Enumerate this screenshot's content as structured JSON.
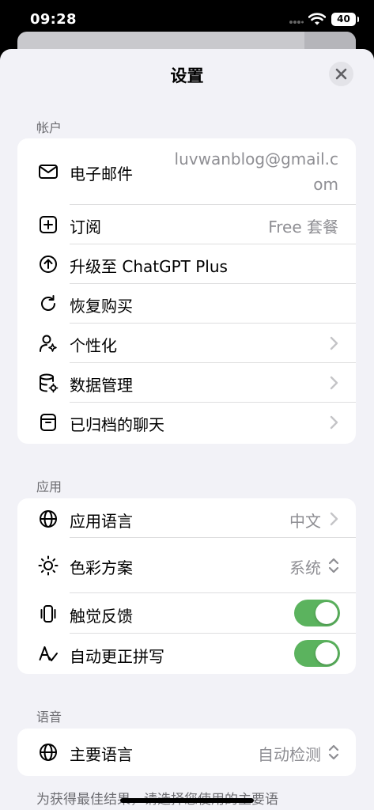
{
  "status_bar": {
    "time": "09:28",
    "battery": "40"
  },
  "sheet": {
    "title": "设置"
  },
  "account": {
    "section_label": "帐户",
    "email": {
      "label": "电子邮件",
      "value_line1": "luvwanblog@gmail.c",
      "value_line2": "om"
    },
    "subscription": {
      "label": "订阅",
      "value": "Free 套餐"
    },
    "upgrade": {
      "label": "升级至 ChatGPT Plus"
    },
    "restore": {
      "label": "恢复购买"
    },
    "personalization": {
      "label": "个性化"
    },
    "data_controls": {
      "label": "数据管理"
    },
    "archived": {
      "label": "已归档的聊天"
    }
  },
  "app": {
    "section_label": "应用",
    "language": {
      "label": "应用语言",
      "value": "中文"
    },
    "color_scheme": {
      "label": "色彩方案",
      "value": "系统"
    },
    "haptics": {
      "label": "触觉反馈",
      "on": true
    },
    "autocorrect": {
      "label": "自动更正拼写",
      "on": true
    }
  },
  "speech": {
    "section_label": "语音",
    "main_language": {
      "label": "主要语言",
      "value": "自动检测"
    },
    "note": "为获得最佳结果，请选择您使用的主要语"
  },
  "icons": [
    "signal-dots-icon",
    "wifi-icon",
    "battery-icon",
    "close-icon",
    "mail-icon",
    "plus-square-icon",
    "arrow-up-circle-icon",
    "restore-icon",
    "person-sparkle-icon",
    "database-gear-icon",
    "archive-box-icon",
    "globe-icon",
    "sun-icon",
    "haptics-phone-icon",
    "autocorrect-icon",
    "chevron-right-icon",
    "chevron-updown-icon"
  ],
  "colors": {
    "toggle_on": "#5bb35e",
    "background": "#f2f2f7",
    "secondary_text": "#8e8e93"
  }
}
